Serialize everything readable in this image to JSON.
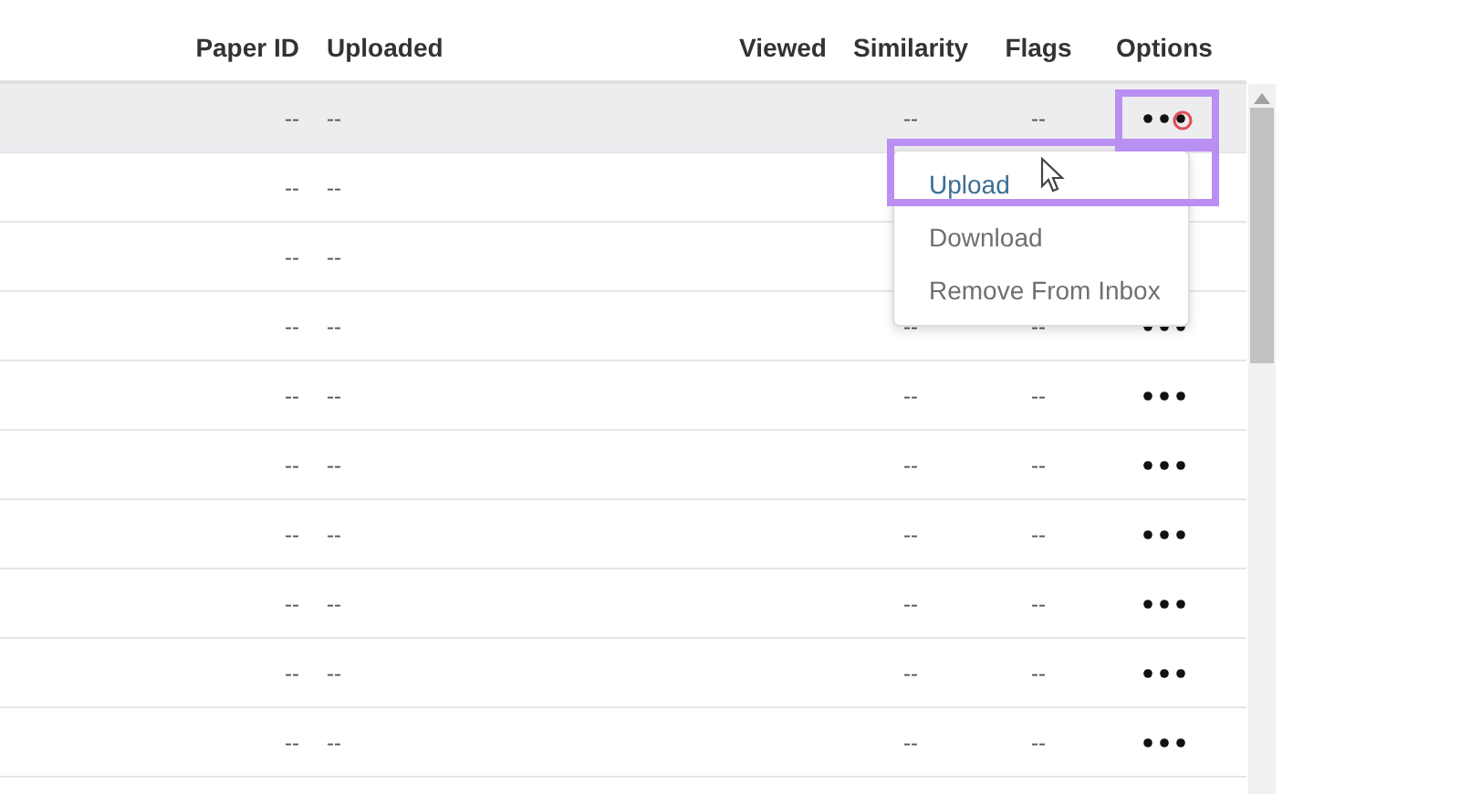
{
  "table": {
    "columns": [
      {
        "label": "Paper ID"
      },
      {
        "label": "Uploaded"
      },
      {
        "label": "Viewed"
      },
      {
        "label": "Similarity"
      },
      {
        "label": "Flags"
      },
      {
        "label": "Options"
      }
    ],
    "rows": [
      {
        "hovered": true,
        "paper_id": "--",
        "uploaded": "--",
        "similarity": "--",
        "flags": "--",
        "options": true
      },
      {
        "hovered": false,
        "paper_id": "--",
        "uploaded": "--"
      },
      {
        "hovered": false,
        "paper_id": "--",
        "uploaded": "--"
      },
      {
        "hovered": false,
        "paper_id": "--",
        "uploaded": "--",
        "similarity": "--",
        "flags": "--",
        "options": true
      },
      {
        "hovered": false,
        "paper_id": "--",
        "uploaded": "--",
        "similarity": "--",
        "flags": "--",
        "options": true
      },
      {
        "hovered": false,
        "paper_id": "--",
        "uploaded": "--",
        "similarity": "--",
        "flags": "--",
        "options": true
      },
      {
        "hovered": false,
        "paper_id": "--",
        "uploaded": "--",
        "similarity": "--",
        "flags": "--",
        "options": true
      },
      {
        "hovered": false,
        "paper_id": "--",
        "uploaded": "--",
        "similarity": "--",
        "flags": "--",
        "options": true
      },
      {
        "hovered": false,
        "paper_id": "--",
        "uploaded": "--",
        "similarity": "--",
        "flags": "--",
        "options": true
      },
      {
        "hovered": false,
        "paper_id": "--",
        "uploaded": "--",
        "similarity": "--",
        "flags": "--",
        "options": true
      }
    ]
  },
  "options_menu": {
    "items": [
      {
        "label": "Upload",
        "selected": true
      },
      {
        "label": "Download",
        "selected": false
      },
      {
        "label": "Remove From Inbox",
        "selected": false
      }
    ]
  }
}
